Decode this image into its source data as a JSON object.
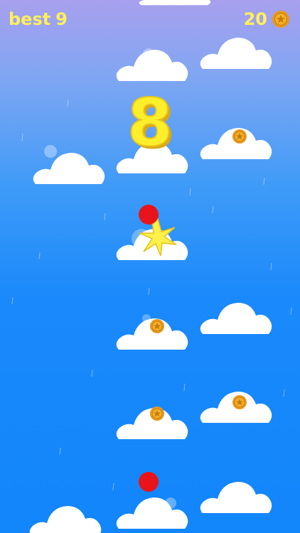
{
  "hud": {
    "best_label": "best",
    "best_value": "9",
    "coin_count": "20"
  },
  "score": "8",
  "icons": {
    "coin": "star-coin-icon",
    "player": "red-ball",
    "impact": "yellow-burst"
  },
  "colors": {
    "sky_top": "#a8a0ee",
    "sky_bottom": "#1286fb",
    "hud_text": "#fff05a",
    "score_text": "#ffee2a",
    "ball": "#e8141a",
    "coin": "#e89a1c",
    "cloud": "#ffffff"
  }
}
